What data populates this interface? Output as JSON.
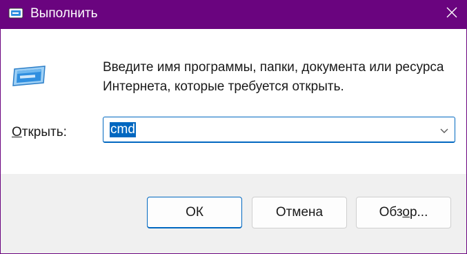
{
  "window": {
    "title": "Выполнить",
    "accent_color": "#6a047f",
    "icons": {
      "app": "run-dialog-icon",
      "close": "close-icon"
    }
  },
  "main": {
    "icon": "run-program-icon",
    "description": "Введите имя программы, папки, документа или ресурса Интернета, которые требуется открыть.",
    "open_label_prefix": "О",
    "open_label_rest": "ткрыть:",
    "combo": {
      "value": "cmd",
      "arrow_icon": "chevron-down-icon"
    }
  },
  "buttons": {
    "ok": "ОК",
    "cancel": "Отмена",
    "browse_prefix": "Обз",
    "browse_accel": "о",
    "browse_suffix": "р..."
  }
}
